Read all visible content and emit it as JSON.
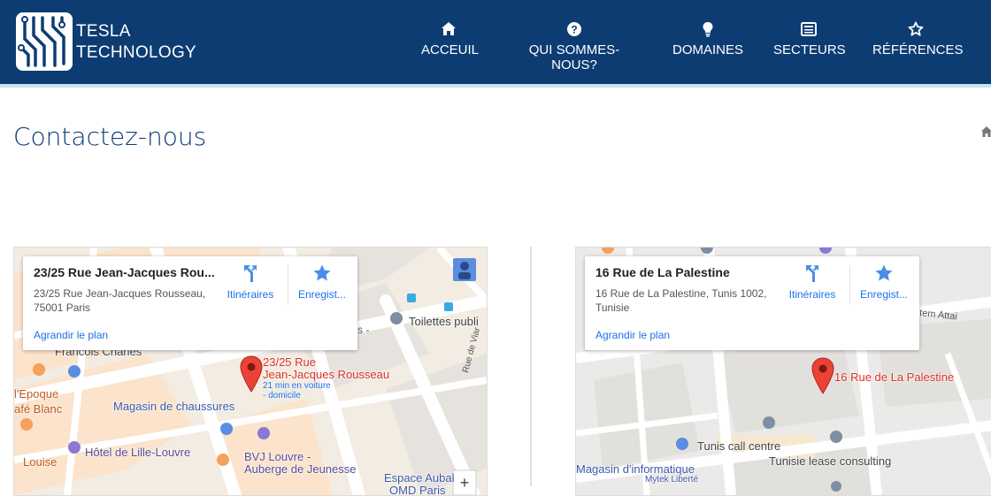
{
  "header": {
    "brand_line1": "TESLA",
    "brand_line2": "TECHNOLOGY",
    "nav": [
      {
        "label": "ACCEUIL",
        "icon": "home-icon"
      },
      {
        "label": "QUI SOMMES-NOUS?",
        "icon": "question-circle-icon"
      },
      {
        "label": "DOMAINES",
        "icon": "lightbulb-icon"
      },
      {
        "label": "SECTEURS",
        "icon": "newspaper-icon"
      },
      {
        "label": "RÉFÉRENCES",
        "icon": "star-outline-icon"
      }
    ]
  },
  "page": {
    "title": "Contactez-nous"
  },
  "maps": [
    {
      "card_title": "23/25 Rue Jean-Jacques Rou...",
      "card_address_line1": "23/25 Rue Jean-Jacques Rousseau,",
      "card_address_line2": "75001 Paris",
      "directions_label": "Itinéraires",
      "save_label": "Enregist...",
      "enlarge_label": "Agrandir le plan",
      "pin_label_line1": "23/25 Rue",
      "pin_label_line2": "Jean-Jacques Rousseau",
      "pin_sub_line1": "21 min en voiture",
      "pin_sub_line2": "- domicile",
      "pois": [
        "Toilettes publi",
        "Francois Charles",
        "l'Epoque",
        "afé Blanc",
        "Magasin de chaussures",
        "Hôtel de Lille-Louvre",
        "BVJ Louvre -",
        "Auberge de Jeunesse",
        "Louise",
        "Espace Aubal",
        "OMD Paris"
      ],
      "streets": [
        "Rue de Viar",
        "s -"
      ]
    },
    {
      "card_title": "16 Rue de La Palestine",
      "card_address_line1": "16 Rue de La Palestine, Tunis 1002,",
      "card_address_line2": "Tunisie",
      "directions_label": "Itinéraires",
      "save_label": "Enregist...",
      "enlarge_label": "Agrandir le plan",
      "pin_label": "16 Rue de La Palestine",
      "pois": [
        "Tunis call centre",
        "Tunisie lease consulting",
        "Magasin d'informatique",
        "Mytek Liberté"
      ],
      "streets": [
        "atem Attai"
      ]
    }
  ],
  "colors": {
    "header_bg": "#0d3c73",
    "header_border": "#c7e4ef",
    "link_blue": "#1a73e8",
    "pin_red": "#d93025"
  }
}
